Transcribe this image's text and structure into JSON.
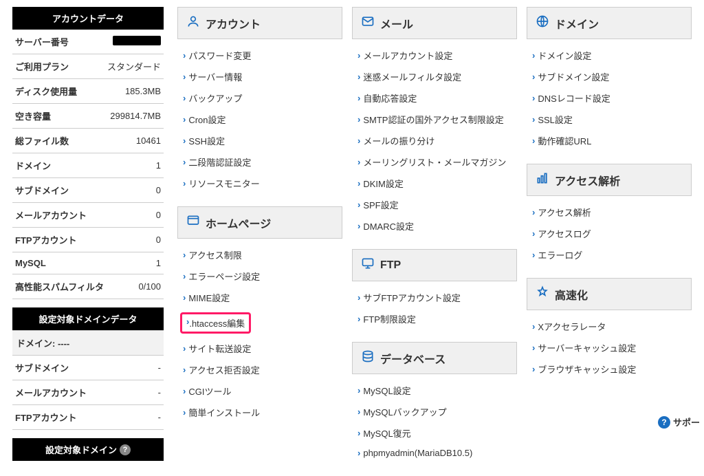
{
  "sidebar": {
    "account_data_header": "アカウントデータ",
    "rows": [
      {
        "label": "サーバー番号",
        "value": "",
        "redacted": true
      },
      {
        "label": "ご利用プラン",
        "value": "スタンダード"
      },
      {
        "label": "ディスク使用量",
        "value": "185.3MB"
      },
      {
        "label": "空き容量",
        "value": "299814.7MB"
      },
      {
        "label": "総ファイル数",
        "value": "10461"
      },
      {
        "label": "ドメイン",
        "value": "1"
      },
      {
        "label": "サブドメイン",
        "value": "0"
      },
      {
        "label": "メールアカウント",
        "value": "0"
      },
      {
        "label": "FTPアカウント",
        "value": "0"
      },
      {
        "label": "MySQL",
        "value": "1"
      },
      {
        "label": "高性能スパムフィルタ",
        "value": "0/100"
      }
    ],
    "domain_data_header": "設定対象ドメインデータ",
    "domain_rows": [
      {
        "label": "ドメイン: ----",
        "value": ""
      },
      {
        "label": "サブドメイン",
        "value": "-"
      },
      {
        "label": "メールアカウント",
        "value": "-"
      },
      {
        "label": "FTPアカウント",
        "value": "-"
      }
    ],
    "target_domain_header": "設定対象ドメイン"
  },
  "panels": {
    "account": {
      "title": "アカウント",
      "items": [
        "パスワード変更",
        "サーバー情報",
        "バックアップ",
        "Cron設定",
        "SSH設定",
        "二段階認証設定",
        "リソースモニター"
      ]
    },
    "mail": {
      "title": "メール",
      "items": [
        "メールアカウント設定",
        "迷惑メールフィルタ設定",
        "自動応答設定",
        "SMTP認証の国外アクセス制限設定",
        "メールの振り分け",
        "メーリングリスト・メールマガジン",
        "DKIM設定",
        "SPF設定",
        "DMARC設定"
      ]
    },
    "domain": {
      "title": "ドメイン",
      "items": [
        "ドメイン設定",
        "サブドメイン設定",
        "DNSレコード設定",
        "SSL設定",
        "動作確認URL"
      ]
    },
    "homepage": {
      "title": "ホームページ",
      "items": [
        "アクセス制限",
        "エラーページ設定",
        "MIME設定",
        ".htaccess編集",
        "サイト転送設定",
        "アクセス拒否設定",
        "CGIツール",
        "簡単インストール"
      ],
      "highlight_index": 3
    },
    "ftp": {
      "title": "FTP",
      "items": [
        "サブFTPアカウント設定",
        "FTP制限設定"
      ]
    },
    "access": {
      "title": "アクセス解析",
      "items": [
        "アクセス解析",
        "アクセスログ",
        "エラーログ"
      ]
    },
    "database": {
      "title": "データベース",
      "items": [
        "MySQL設定",
        "MySQLバックアップ",
        "MySQL復元",
        "phpmyadmin(MariaDB10.5)"
      ]
    },
    "speed": {
      "title": "高速化",
      "items": [
        "Xアクセラレータ",
        "サーバーキャッシュ設定",
        "ブラウザキャッシュ設定"
      ]
    }
  },
  "help_float": "サポー"
}
